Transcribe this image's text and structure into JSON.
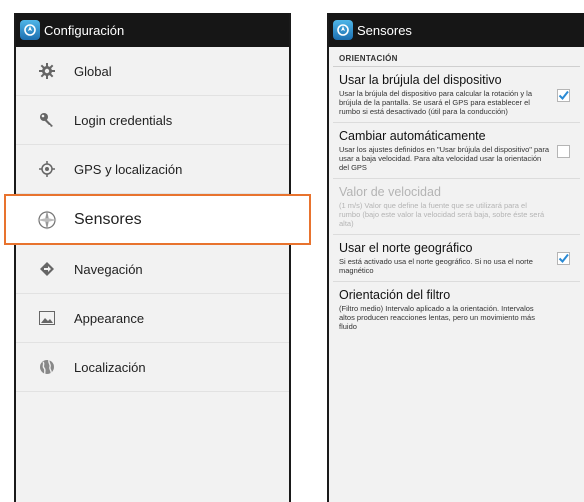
{
  "left_panel": {
    "title": "Configuración",
    "items": [
      {
        "label": "Global",
        "icon": "gear-icon"
      },
      {
        "label": "Login credentials",
        "icon": "key-icon"
      },
      {
        "label": "GPS y localización",
        "icon": "crosshair-icon"
      },
      {
        "label": "Sensores",
        "icon": "compass-icon",
        "selected": true
      },
      {
        "label": "Navegación",
        "icon": "direction-icon"
      },
      {
        "label": "Appearance",
        "icon": "picture-icon"
      },
      {
        "label": "Localización",
        "icon": "globe-icon"
      }
    ]
  },
  "right_panel": {
    "title": "Sensores",
    "section_header": "ORIENTACIÓN",
    "prefs": [
      {
        "title": "Usar la brújula del dispositivo",
        "summary": "Usar la brújula del dispositivo para calcular la rotación y la brújula de la pantalla. Se usará el GPS para establecer el rumbo si está desactivado (útil para la conducción)",
        "checked": true
      },
      {
        "title": "Cambiar automáticamente",
        "summary": "Usar los ajustes definidos en \"Usar brújula del dispositivo\" para usar a baja velocidad. Para alta velocidad usar la orientación del GPS",
        "checked": false
      },
      {
        "title": "Valor de velocidad",
        "summary": "(1 m/s) Valor que define la fuente que se utilizará para el rumbo (bajo este valor la velocidad será baja, sobre éste será alta)",
        "disabled": true
      },
      {
        "title": "Usar el norte geográfico",
        "summary": "Si está activado usa el norte geográfico. Si no usa el norte magnético",
        "checked": true
      },
      {
        "title": "Orientación del filtro",
        "summary": "(Filtro medio) Intervalo aplicado a la orientación. Intervalos altos producen reacciones lentas, pero un movimiento más fluido"
      }
    ]
  },
  "colors": {
    "highlight": "#e8732e",
    "check": "#2a8ad4",
    "actionbar": "#161616"
  }
}
